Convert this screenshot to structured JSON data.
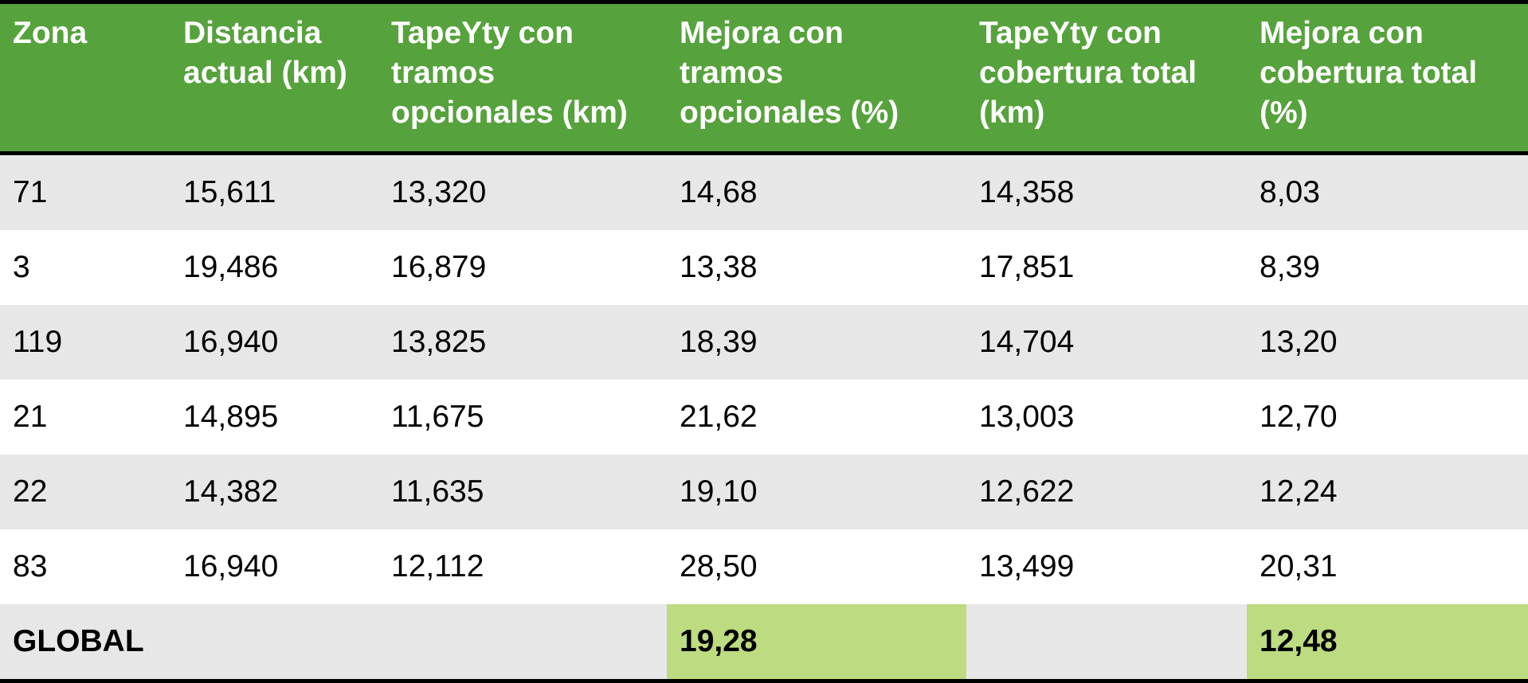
{
  "table": {
    "headers": [
      "Zona",
      "Distancia\nactual (km)",
      "TapeYty con\ntramos\nopcionales (km)",
      "Mejora con\ntramos\nopcionales (%)",
      "TapeYty con\ncobertura total\n(km)",
      "Mejora con\ncobertura total\n(%)"
    ],
    "rows": [
      [
        "71",
        "15,611",
        "13,320",
        "14,68",
        "14,358",
        "8,03"
      ],
      [
        "3",
        "19,486",
        "16,879",
        "13,38",
        "17,851",
        "8,39"
      ],
      [
        "119",
        "16,940",
        "13,825",
        "18,39",
        "14,704",
        "13,20"
      ],
      [
        "21",
        "14,895",
        "11,675",
        "21,62",
        "13,003",
        "12,70"
      ],
      [
        "22",
        "14,382",
        "11,635",
        "19,10",
        "12,622",
        "12,24"
      ],
      [
        "83",
        "16,940",
        "12,112",
        "28,50",
        "13,499",
        "20,31"
      ]
    ],
    "global": {
      "label": "GLOBAL",
      "mejora_tramos": "19,28",
      "mejora_cobertura": "12,48"
    }
  },
  "colors": {
    "header_bg": "#56a23c",
    "header_text": "#ffffff",
    "row_shade": "#e7e7e7",
    "row_plain": "#ffffff",
    "highlight": "#bddb80",
    "rule": "#000000"
  }
}
